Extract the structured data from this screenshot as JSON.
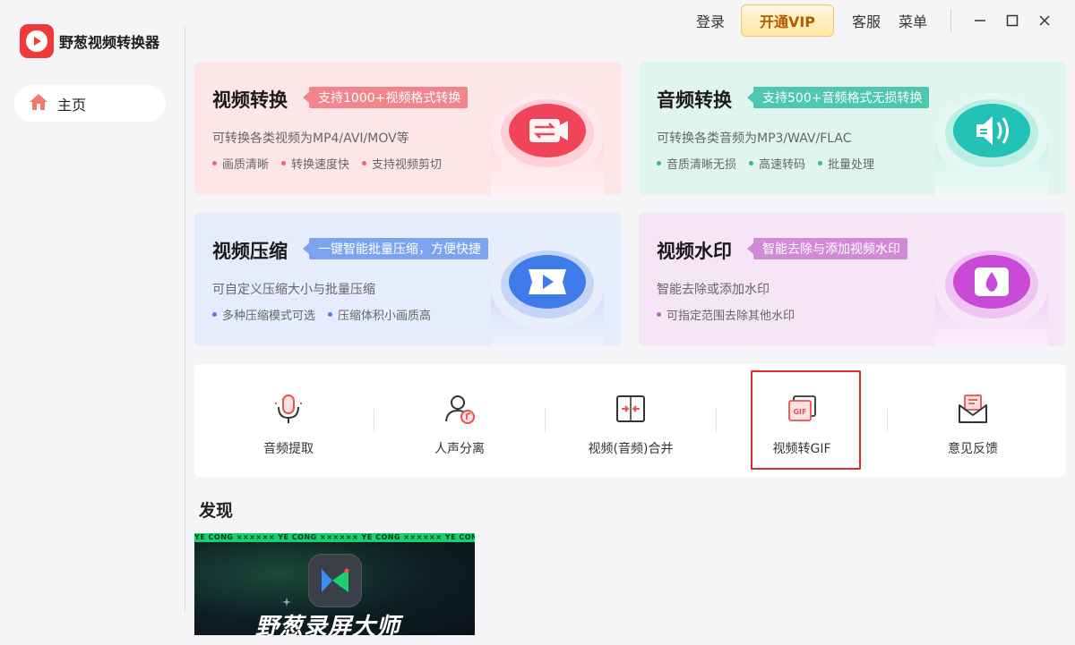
{
  "app": {
    "name": "野葱视频转换器"
  },
  "sidebar": {
    "home_label": "主页"
  },
  "topbar": {
    "login": "登录",
    "vip": "开通VIP",
    "service": "客服",
    "menu": "菜单"
  },
  "cards": [
    {
      "title": "视频转换",
      "tag": "支持1000+视频格式转换",
      "desc": "可转换各类视频为MP4/AVI/MOV等",
      "features": [
        "画质清晰",
        "转换速度快",
        "支持视频剪切"
      ],
      "bg": "#fde6e8",
      "tag_color": "#f2848c",
      "dot_color": "#f0636f",
      "icon_color": "#f0445a"
    },
    {
      "title": "音频转换",
      "tag": "支持500+音频格式无损转换",
      "desc": "可转换各类音频为MP3/WAV/FLAC",
      "features": [
        "音质清晰无损",
        "高速转码",
        "批量处理"
      ],
      "bg": "#dff5ee",
      "tag_color": "#4dc7b0",
      "dot_color": "#2fb99e",
      "icon_color": "#22c2b6"
    },
    {
      "title": "视频压缩",
      "tag": "一键智能批量压缩，方便快捷",
      "desc": "可自定义压缩大小与批量压缩",
      "features": [
        "多种压缩模式可选",
        "压缩体积小画质高"
      ],
      "bg": "#e5ecfb",
      "tag_color": "#7da2ef",
      "dot_color": "#4d7fe8",
      "icon_color": "#3f7be9"
    },
    {
      "title": "视频水印",
      "tag": "智能去除与添加视频水印",
      "desc": "智能去除或添加水印",
      "features": [
        "可指定范围去除其他水印"
      ],
      "bg": "#f6e4f7",
      "tag_color": "#d28ad7",
      "dot_color": "#c361cc",
      "icon_color": "#c94ad6"
    }
  ],
  "tools": [
    {
      "label": "音频提取",
      "icon": "microphone-icon"
    },
    {
      "label": "人声分离",
      "icon": "vocal-separation-icon"
    },
    {
      "label": "视频(音频)合并",
      "icon": "merge-icon"
    },
    {
      "label": "视频转GIF",
      "icon": "gif-icon"
    },
    {
      "label": "意见反馈",
      "icon": "feedback-mail-icon"
    }
  ],
  "discover": {
    "title": "发现",
    "banner_strip": "YE CONG ×××××× YE CONG ×××××× YE CONG ×××××× YE CONG ×××××× YE CONG",
    "banner_title": "野葱录屏大师"
  },
  "colors": {
    "accent_red": "#e42828",
    "vip_text": "#b55a00"
  }
}
